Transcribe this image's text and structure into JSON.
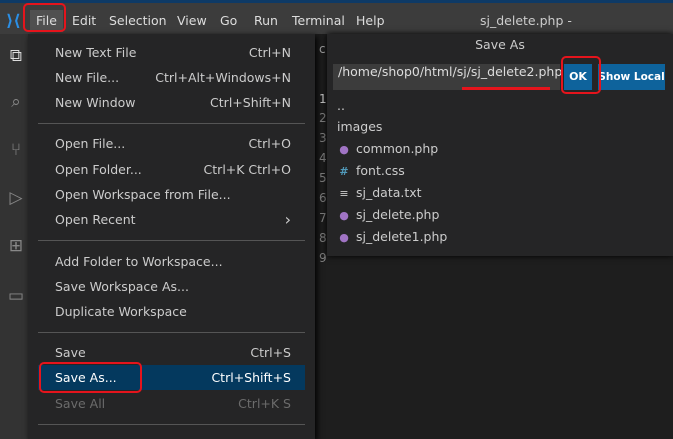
{
  "titlebar": {
    "menus": [
      "File",
      "Edit",
      "Selection",
      "View",
      "Go",
      "Run",
      "Terminal",
      "Help"
    ],
    "window_title": "sj_delete.php -"
  },
  "file_menu": {
    "items": [
      {
        "label": "New Text File",
        "shortcut": "Ctrl+N"
      },
      {
        "label": "New File...",
        "shortcut": "Ctrl+Alt+Windows+N"
      },
      {
        "label": "New Window",
        "shortcut": "Ctrl+Shift+N"
      },
      {
        "label": "Open File...",
        "shortcut": "Ctrl+O"
      },
      {
        "label": "Open Folder...",
        "shortcut": "Ctrl+K Ctrl+O"
      },
      {
        "label": "Open Workspace from File...",
        "shortcut": ""
      },
      {
        "label": "Open Recent",
        "shortcut": "›"
      },
      {
        "label": "Add Folder to Workspace...",
        "shortcut": ""
      },
      {
        "label": "Save Workspace As...",
        "shortcut": ""
      },
      {
        "label": "Duplicate Workspace",
        "shortcut": ""
      },
      {
        "label": "Save",
        "shortcut": "Ctrl+S"
      },
      {
        "label": "Save As...",
        "shortcut": "Ctrl+Shift+S"
      },
      {
        "label": "Save All",
        "shortcut": "Ctrl+K S"
      }
    ]
  },
  "editor": {
    "tab_fragment": "c",
    "line_numbers": [
      "1",
      "2",
      "3",
      "4",
      "5",
      "6",
      "7",
      "8",
      "9"
    ]
  },
  "save_as": {
    "title": "Save As",
    "path": "/home/shop0/html/sj/sj_delete2.php",
    "ok_label": "OK",
    "show_local_label": "Show Local",
    "entries": [
      {
        "name": "..",
        "icon": ""
      },
      {
        "name": "images",
        "icon": ""
      },
      {
        "name": "common.php",
        "icon": "php-elephant-icon"
      },
      {
        "name": "font.css",
        "icon": "hash-icon"
      },
      {
        "name": "sj_data.txt",
        "icon": "lines-icon"
      },
      {
        "name": "sj_delete.php",
        "icon": "php-elephant-icon"
      },
      {
        "name": "sj_delete1.php",
        "icon": "php-elephant-icon"
      }
    ]
  },
  "colors": {
    "accent": "#0e639c",
    "highlight": "#04395e",
    "annotation": "#e5141c"
  }
}
